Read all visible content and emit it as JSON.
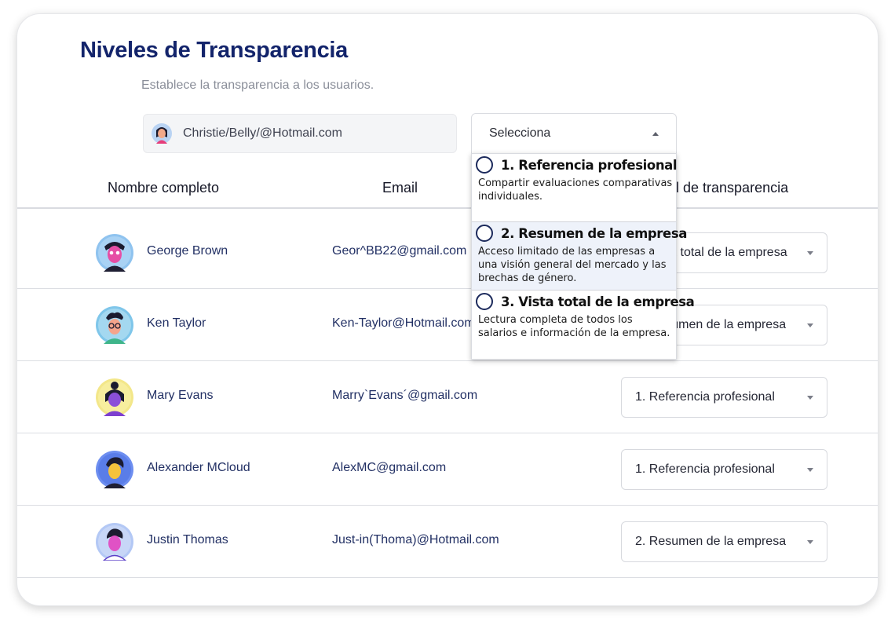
{
  "header": {
    "title": "Niveles de Transparencia",
    "subtitle": "Establece la transparencia a los usuarios."
  },
  "selected_user": {
    "email": "Christie/Belly/@Hotmail.com"
  },
  "level_select": {
    "placeholder": "Selecciona",
    "options": [
      {
        "title": "1. Referencia profesional",
        "description": "Compartir evaluaciones comparativas individuales."
      },
      {
        "title": "2. Resumen de la empresa",
        "description": "Acceso limitado de las empresas a una visión general del mercado y las brechas de género."
      },
      {
        "title": "3. Vista total de la empresa",
        "description": "Lectura completa de todos los salarios e información de la empresa."
      }
    ]
  },
  "table": {
    "headers": [
      "Nombre completo",
      "Email",
      "Nivel de transparencia"
    ],
    "rows": [
      {
        "name": "George Brown",
        "email": "Geor^BB22@gmail.com",
        "level": "3. Vista total de la empresa"
      },
      {
        "name": "Ken Taylor",
        "email": "Ken-Taylor@Hotmail.com",
        "level": "2. Resumen de la empresa"
      },
      {
        "name": "Mary Evans",
        "email": "Marry`Evans´@gmail.com",
        "level": "1. Referencia profesional"
      },
      {
        "name": "Alexander MCloud",
        "email": "AlexMC@gmail.com",
        "level": "1. Referencia profesional"
      },
      {
        "name": "Justin Thomas",
        "email": "Just-in(Thoma)@Hotmail.com",
        "level": "2. Resumen de la empresa"
      }
    ]
  },
  "colors": {
    "title": "#13246b",
    "text": "#223064",
    "highlight": "#eef2fa"
  },
  "icons": [
    "avatar-icon",
    "caret-up-icon",
    "caret-down-icon",
    "radio-icon"
  ]
}
